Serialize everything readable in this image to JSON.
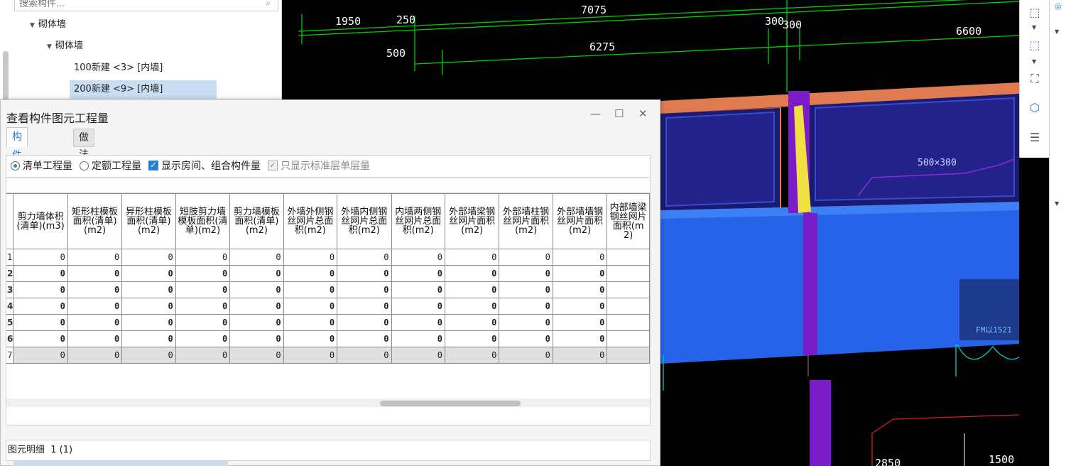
{
  "tree": {
    "search_placeholder": "搜索构件...",
    "items": [
      {
        "label": "砌体墙"
      },
      {
        "label": "砌体墙"
      },
      {
        "label": "100新建 <3> [内墙]"
      },
      {
        "label": "200新建 <9> [内墙]"
      }
    ]
  },
  "cad": {
    "dims": [
      "7075",
      "1950",
      "250",
      "300",
      "300",
      "6600",
      "500",
      "6275",
      "2850",
      "1500"
    ],
    "labels": [
      "500×300",
      "FM以1521"
    ]
  },
  "dialog": {
    "title": "查看构件图元工程量",
    "controls": {
      "minimize": "—",
      "maximize": "☐",
      "close": "✕"
    },
    "tabs": [
      {
        "label": "构件工程量"
      },
      {
        "label": "做法工程量"
      }
    ],
    "options": {
      "radio_qingdan": "清单工程量",
      "radio_dinge": "定额工程量",
      "check_room": "显示房间、组合构件量",
      "check_standard": "只显示标准层单层量"
    },
    "columns": [
      "剪力墙体积(清单)(m3)",
      "矩形柱模板面积(清单)(m2)",
      "异形柱模板面积(清单)(m2)",
      "短肢剪力墙模板面积(清单)(m2)",
      "剪力墙模板面积(清单)(m2)",
      "外墙外侧钢丝网片总面积(m2)",
      "外墙内侧钢丝网片总面积(m2)",
      "内墙两侧钢丝网片总面积(m2)",
      "外部墙梁钢丝网片面积(m2)",
      "外部墙柱钢丝网片面积(m2)",
      "外部墙墙钢丝网片面积(m2)",
      "内部墙梁钢丝网片面积(m2)"
    ],
    "rows": [
      {
        "n": "1",
        "v": [
          "0",
          "0",
          "0",
          "0",
          "0",
          "0",
          "0",
          "0",
          "0",
          "0",
          "0",
          ""
        ]
      },
      {
        "n": "2",
        "v": [
          "0",
          "0",
          "0",
          "0",
          "0",
          "0",
          "0",
          "0",
          "0",
          "0",
          "0",
          ""
        ]
      },
      {
        "n": "3",
        "v": [
          "0",
          "0",
          "0",
          "0",
          "0",
          "0",
          "0",
          "0",
          "0",
          "0",
          "0",
          ""
        ]
      },
      {
        "n": "4",
        "v": [
          "0",
          "0",
          "0",
          "0",
          "0",
          "0",
          "0",
          "0",
          "0",
          "0",
          "0",
          ""
        ]
      },
      {
        "n": "5",
        "v": [
          "0",
          "0",
          "0",
          "0",
          "0",
          "0",
          "0",
          "0",
          "0",
          "0",
          "0",
          ""
        ]
      },
      {
        "n": "6",
        "v": [
          "0",
          "0",
          "0",
          "0",
          "0",
          "0",
          "0",
          "0",
          "0",
          "0",
          "0",
          ""
        ]
      },
      {
        "n": "7",
        "v": [
          "0",
          "0",
          "0",
          "0",
          "0",
          "0",
          "0",
          "0",
          "0",
          "0",
          "0",
          ""
        ]
      }
    ],
    "detail_label": "图元明细",
    "detail_count": "1 (1)"
  },
  "colors": {
    "accent": "#2a7fd0",
    "cad_background": "#000000",
    "wall_blue": "#2563e8",
    "dim_green": "#00d000",
    "purple": "#7a1cc8",
    "orange": "#e07a50"
  }
}
